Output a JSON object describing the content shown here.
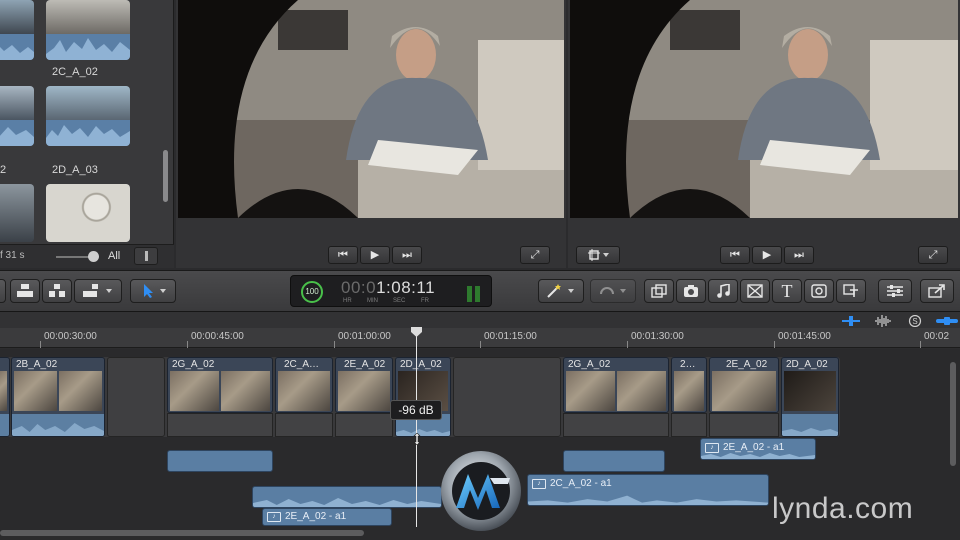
{
  "browser": {
    "clips": [
      {
        "label": ""
      },
      {
        "label": "2C_A_02"
      },
      {
        "label": "2"
      },
      {
        "label": "2D_A_03"
      },
      {
        "label": ""
      },
      {
        "label": ""
      }
    ],
    "clip_count": "f 31 s",
    "zoom_label": "All"
  },
  "viewer_event": {
    "buttons": [
      "⏮",
      "▶",
      "⏭",
      "⤢"
    ]
  },
  "viewer_main": {
    "buttons": [
      "⏮",
      "▶",
      "⏭",
      "⤢"
    ]
  },
  "toolbar": {
    "timecode": {
      "percent": "100",
      "dim_part": "00:0",
      "value": "1:08:11",
      "units": [
        "HR",
        "MIN",
        "SEC",
        "FR"
      ]
    },
    "text_tool": "T"
  },
  "timeline": {
    "ruler_labels": [
      "00:00:30:00",
      "00:00:45:00",
      "00:01:00:00",
      "00:01:15:00",
      "00:01:30:00",
      "00:01:45:00",
      "00:02"
    ],
    "video_clips": [
      {
        "name": "2B_A_02"
      },
      {
        "name": "2G_A_02"
      },
      {
        "name": "2C_A…"
      },
      {
        "name": "2E_A_02"
      },
      {
        "name": "2D_A_02"
      },
      {
        "name": "2G_A_02"
      },
      {
        "name": "2…"
      },
      {
        "name": "2E_A_02"
      },
      {
        "name": "2D_A_02"
      }
    ],
    "audio_clips": [
      {
        "name": "2E_A_02 - a1"
      },
      {
        "name": "2C_A_02 - a1"
      },
      {
        "name": "2E_A_02 - a1"
      }
    ],
    "volume_tooltip": "-96 dB"
  },
  "watermark": "lynda.com",
  "colors": {
    "accent": "#2f8ef4",
    "audio": "#5a7ea3",
    "timecode_green": "#49c04a"
  }
}
